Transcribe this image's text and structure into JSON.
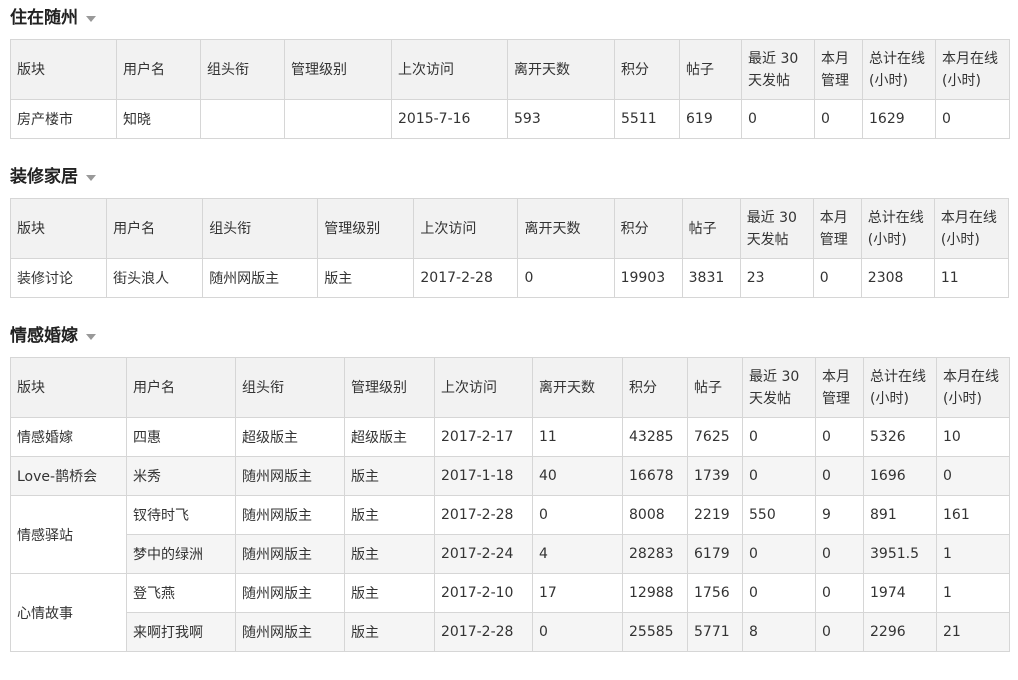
{
  "headers": [
    "版块",
    "用户名",
    "组头衔",
    "管理级别",
    "上次访问",
    "离开天数",
    "积分",
    "帖子",
    "最近 30 天发帖",
    "本月管理",
    "总计在线(小时)",
    "本月在线(小时)"
  ],
  "sections": [
    {
      "title": "住在随州",
      "rows": [
        {
          "board": "房产楼市",
          "user": "知晓",
          "title": "",
          "level": "",
          "last": "2015-7-16",
          "days": "593",
          "points": "5511",
          "posts": "619",
          "recent": "0",
          "manage": "0",
          "total": "1629",
          "month": "0"
        }
      ]
    },
    {
      "title": "装修家居",
      "rows": [
        {
          "board": "装修讨论",
          "user": "街头浪人",
          "title": "随州网版主",
          "level": "版主",
          "last": "2017-2-28",
          "days": "0",
          "points": "19903",
          "posts": "3831",
          "recent": "23",
          "manage": "0",
          "total": "2308",
          "month": "11"
        }
      ]
    },
    {
      "title": "情感婚嫁",
      "rows": [
        {
          "board": "情感婚嫁",
          "user": "四惠",
          "title": "超级版主",
          "level": "超级版主",
          "last": "2017-2-17",
          "days": "11",
          "points": "43285",
          "posts": "7625",
          "recent": "0",
          "manage": "0",
          "total": "5326",
          "month": "10"
        },
        {
          "board": "Love-鹊桥会",
          "user": "米秀",
          "title": "随州网版主",
          "level": "版主",
          "last": "2017-1-18",
          "days": "40",
          "points": "16678",
          "posts": "1739",
          "recent": "0",
          "manage": "0",
          "total": "1696",
          "month": "0"
        },
        {
          "board": "情感驿站",
          "user": "钗待时飞",
          "title": "随州网版主",
          "level": "版主",
          "last": "2017-2-28",
          "days": "0",
          "points": "8008",
          "posts": "2219",
          "recent": "550",
          "manage": "9",
          "total": "891",
          "month": "161"
        },
        {
          "board": "",
          "user": "梦中的绿洲",
          "title": "随州网版主",
          "level": "版主",
          "last": "2017-2-24",
          "days": "4",
          "points": "28283",
          "posts": "6179",
          "recent": "0",
          "manage": "0",
          "total": "3951.5",
          "month": "1"
        },
        {
          "board": "心情故事",
          "user": "登飞燕",
          "title": "随州网版主",
          "level": "版主",
          "last": "2017-2-10",
          "days": "17",
          "points": "12988",
          "posts": "1756",
          "recent": "0",
          "manage": "0",
          "total": "1974",
          "month": "1"
        },
        {
          "board": "",
          "user": "来啊打我啊",
          "title": "随州网版主",
          "level": "版主",
          "last": "2017-2-28",
          "days": "0",
          "points": "25585",
          "posts": "5771",
          "recent": "8",
          "manage": "0",
          "total": "2296",
          "month": "21"
        }
      ]
    }
  ]
}
